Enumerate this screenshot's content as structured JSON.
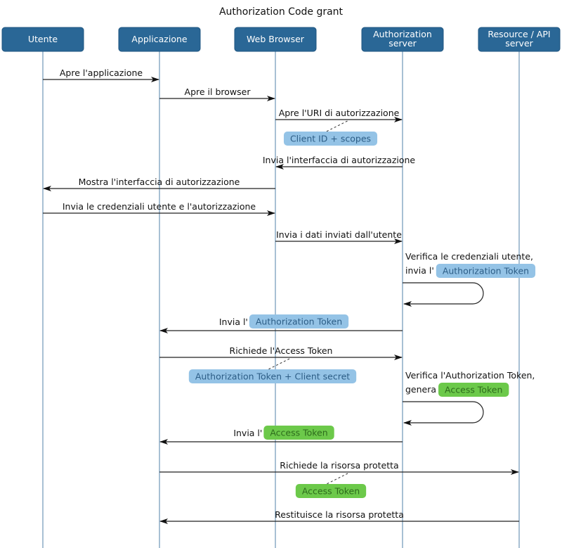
{
  "title": "Authorization Code grant",
  "actors": [
    {
      "id": "utente",
      "lines": [
        "Utente"
      ]
    },
    {
      "id": "applicazione",
      "lines": [
        "Applicazione"
      ]
    },
    {
      "id": "browser",
      "lines": [
        "Web Browser"
      ]
    },
    {
      "id": "authserver",
      "lines": [
        "Authorization",
        "server"
      ]
    },
    {
      "id": "resource",
      "lines": [
        "Resource / API",
        "server"
      ]
    }
  ],
  "messages": [
    {
      "from": "utente",
      "to": "applicazione",
      "label": "Apre l'applicazione"
    },
    {
      "from": "applicazione",
      "to": "browser",
      "label": "Apre il browser"
    },
    {
      "from": "browser",
      "to": "authserver",
      "label": "Apre l'URI di autorizzazione",
      "note": {
        "text": "Client ID + scopes",
        "color": "blue"
      }
    },
    {
      "from": "authserver",
      "to": "browser",
      "label": "Invia l'interfaccia di autorizzazione"
    },
    {
      "from": "browser",
      "to": "utente",
      "label": "Mostra l'interfaccia di autorizzazione"
    },
    {
      "from": "utente",
      "to": "browser",
      "label": "Invia le credenziali utente e l'autorizzazione"
    },
    {
      "from": "browser",
      "to": "authserver",
      "label": "Invia i dati inviati dall'utente"
    },
    {
      "from": "authserver",
      "to": "authserver",
      "label": "Verifica le credenziali utente,",
      "label2": "invia l'",
      "pill": {
        "text": "Authorization Token",
        "color": "blue"
      }
    },
    {
      "from": "authserver",
      "to": "applicazione",
      "label": "Invia l'",
      "pill": {
        "text": "Authorization Token",
        "color": "blue"
      }
    },
    {
      "from": "applicazione",
      "to": "authserver",
      "label": "Richiede l'Access Token",
      "note": {
        "text": "Authorization Token + Client secret",
        "color": "blue"
      }
    },
    {
      "from": "authserver",
      "to": "authserver",
      "label": "Verifica l'Authorization Token,",
      "label2": "genera",
      "pill": {
        "text": "Access Token",
        "color": "green"
      }
    },
    {
      "from": "authserver",
      "to": "applicazione",
      "label": "Invia l'",
      "pill": {
        "text": "Access Token",
        "color": "green"
      }
    },
    {
      "from": "applicazione",
      "to": "resource",
      "label": "Richiede la risorsa protetta",
      "note": {
        "text": "Access Token",
        "color": "green"
      }
    },
    {
      "from": "resource",
      "to": "applicazione",
      "label": "Restituisce la risorsa protetta"
    }
  ]
}
